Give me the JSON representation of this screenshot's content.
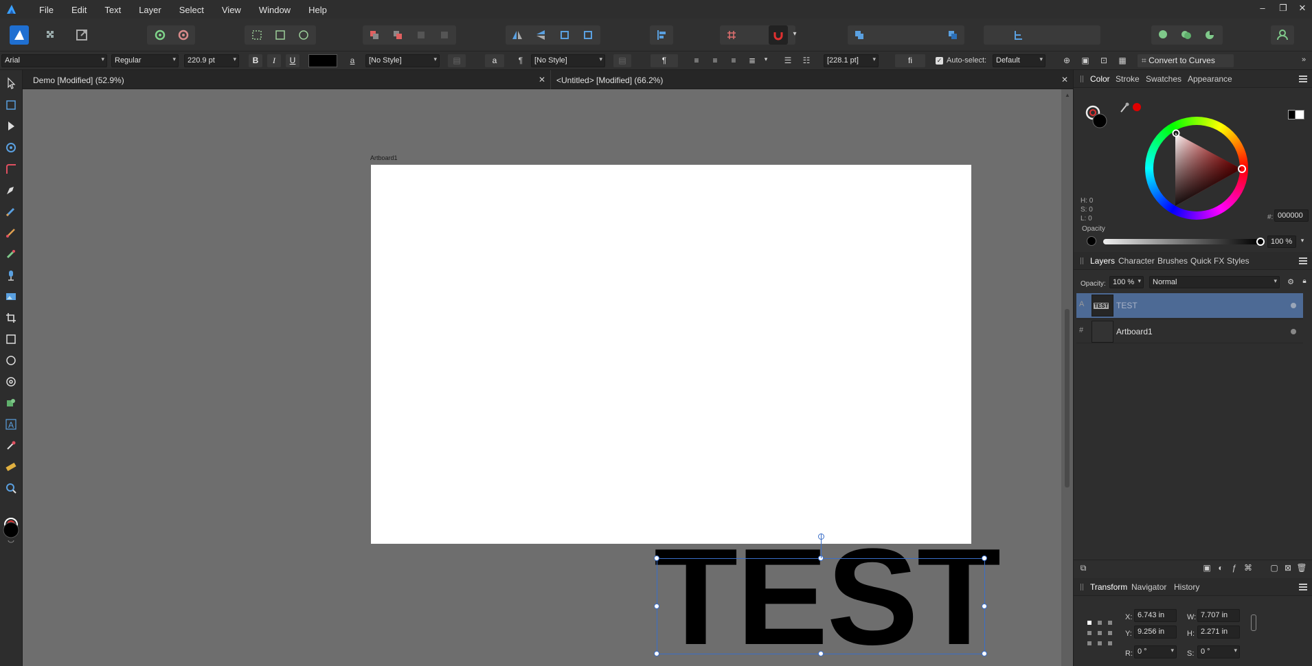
{
  "app": {
    "menu": [
      "File",
      "Edit",
      "Text",
      "Layer",
      "Select",
      "View",
      "Window",
      "Help"
    ],
    "window_controls": {
      "minimize": "–",
      "restore": "❐",
      "close": "✕"
    }
  },
  "context_toolbar": {
    "font_family": "Arial",
    "font_style": "Regular",
    "font_size": "220.9 pt",
    "bold": "B",
    "italic": "I",
    "underline": "U",
    "char_style_icon": "a",
    "char_style": "[No Style]",
    "char_btn": "a",
    "para_mark": "¶",
    "para_style": "[No Style]",
    "para_btn": "¶",
    "leading": "[228.1 pt]",
    "ligature": "fi",
    "auto_select_label": "Auto-select:",
    "auto_select_value": "Default",
    "convert_to_curves": "Convert to Curves",
    "overflow": "»"
  },
  "documents": {
    "tabs": [
      {
        "label": "Demo [Modified] (52.9%)",
        "close": "✕"
      },
      {
        "label": "<Untitled> [Modified] (66.2%)",
        "close": "✕"
      }
    ]
  },
  "canvas": {
    "artboard_label": "Artboard1",
    "text_content": "TEST"
  },
  "color_panel": {
    "tabs": [
      "Color",
      "Stroke",
      "Swatches",
      "Appearance"
    ],
    "hsl": {
      "h": "H: 0",
      "s": "S: 0",
      "l": "L: 0"
    },
    "hex_prefix": "#:",
    "hex": "000000",
    "opacity_label": "Opacity",
    "opacity_value": "100 %",
    "accent_color": "#e00000"
  },
  "layers_panel": {
    "tabs": [
      "Layers",
      "Character",
      "Brushes",
      "Quick FX",
      "Styles"
    ],
    "opacity_label": "Opacity:",
    "opacity_value": "100 %",
    "blend_mode": "Normal",
    "layers": [
      {
        "kind": "A",
        "name": "TEST",
        "thumb": "TEST",
        "selected": true
      },
      {
        "kind": "#",
        "name": "Artboard1",
        "thumb": "",
        "selected": false
      }
    ]
  },
  "transform_panel": {
    "tabs": [
      "Transform",
      "Navigator",
      "History"
    ],
    "x_label": "X:",
    "x": "6.743 in",
    "y_label": "Y:",
    "y": "9.256 in",
    "w_label": "W:",
    "w": "7.707 in",
    "h_label": "H:",
    "h": "2.271 in",
    "r_label": "R:",
    "r": "0 °",
    "s_label": "S:",
    "s": "0 °"
  },
  "colors": {
    "selection": "#3a6ec8",
    "selected_row": "#4d6a95",
    "canvas_bg": "#6e6e6e"
  }
}
